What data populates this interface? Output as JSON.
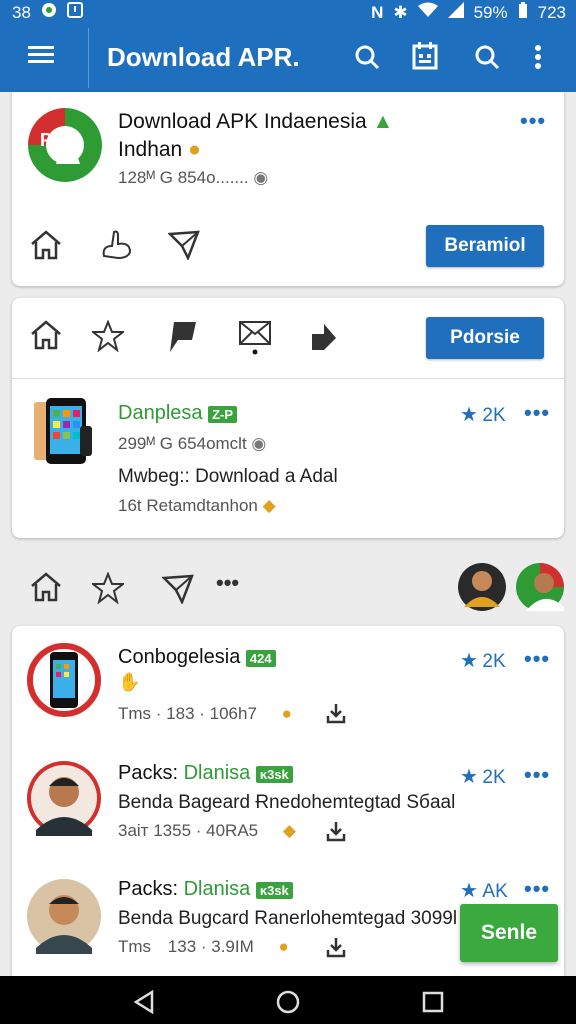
{
  "status_bar": {
    "left_number": "38",
    "right_text": "59%",
    "time": "723"
  },
  "app_bar": {
    "title": "Download APR."
  },
  "featured": {
    "name_line1": "Download APK Indaenesia",
    "name_line2": "Indhan",
    "meta": "128ᴹ  G 854o.......",
    "action_button": "Beramiol"
  },
  "toolbar_card": {
    "action_button": "Pdorsie",
    "app": {
      "name": "Danplesa",
      "badge": "Z-P",
      "rating": "2K",
      "meta": "299ᴹ  G 654omclt",
      "desc": "Mwbeg:: Download a Adal",
      "sub": "16t Retamdtanhon"
    }
  },
  "list_card": {
    "items": [
      {
        "name": "Conbogelesia",
        "badge": "424",
        "rating": "2K",
        "meta1": "Tms",
        "meta2": "183 · 106h7"
      },
      {
        "prefix": "Packs:",
        "name": "Dlanisa",
        "badge": "ĸ3sk",
        "rating": "2K",
        "desc": "Benda Bageard Ɍnedohemtegtad Sбaal",
        "meta1": "3aiт",
        "meta2": "1355 · 40RA5"
      },
      {
        "prefix": "Packs:",
        "name": "Dlanisa",
        "badge": "ĸ3sk",
        "rating": "AK",
        "desc": "Benda Bugcard Ranerlohemtegad 3099l",
        "meta1": "Tms",
        "meta2": "133 · 3.9IM"
      }
    ],
    "floating_button": "Senle"
  },
  "colors": {
    "primary": "#1e6fbd",
    "accent_green": "#3aaa3f"
  }
}
